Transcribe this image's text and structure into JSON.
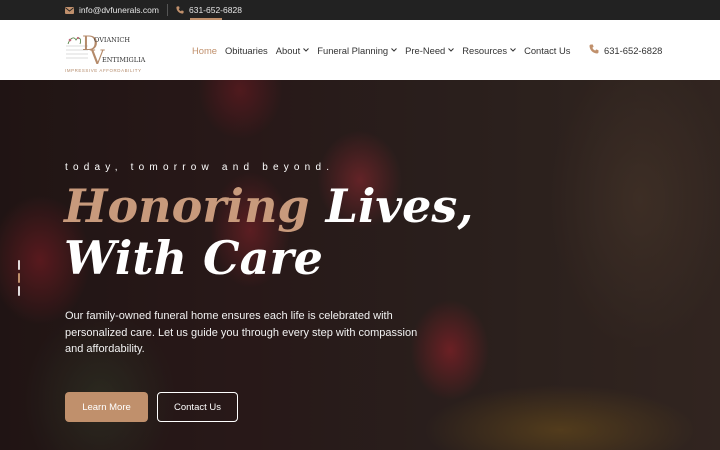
{
  "topbar": {
    "email": "info@dvfunerals.com",
    "phone": "631-652-6828",
    "icons": [
      "envelope-icon",
      "phone-icon"
    ]
  },
  "logo": {
    "line1": "DOVIANICH",
    "line2": "VENTIMIGLIA",
    "tagline": "IMPRESSIVE AFFORDABILITY"
  },
  "nav": {
    "items": [
      {
        "label": "Home",
        "active": true,
        "dropdown": false
      },
      {
        "label": "Obituaries",
        "active": false,
        "dropdown": false
      },
      {
        "label": "About",
        "active": false,
        "dropdown": true
      },
      {
        "label": "Funeral Planning",
        "active": false,
        "dropdown": true
      },
      {
        "label": "Pre-Need",
        "active": false,
        "dropdown": true
      },
      {
        "label": "Resources",
        "active": false,
        "dropdown": true
      },
      {
        "label": "Contact Us",
        "active": false,
        "dropdown": false
      }
    ],
    "phone": "631-652-6828"
  },
  "hero": {
    "tagline": "today, tomorrow and beyond.",
    "headline_accent": "Honoring",
    "headline_rest": " Lives,",
    "headline_line2": "With Care",
    "description": "Our family-owned funeral home ensures each life is celebrated with personalized care. Let us guide you through every step with compassion and affordability.",
    "primary_button": "Learn More",
    "secondary_button": "Contact Us",
    "slide_count": 3,
    "active_slide": 2
  },
  "colors": {
    "accent": "#c0906c",
    "topbar_bg": "#222222",
    "header_bg": "#ffffff"
  }
}
